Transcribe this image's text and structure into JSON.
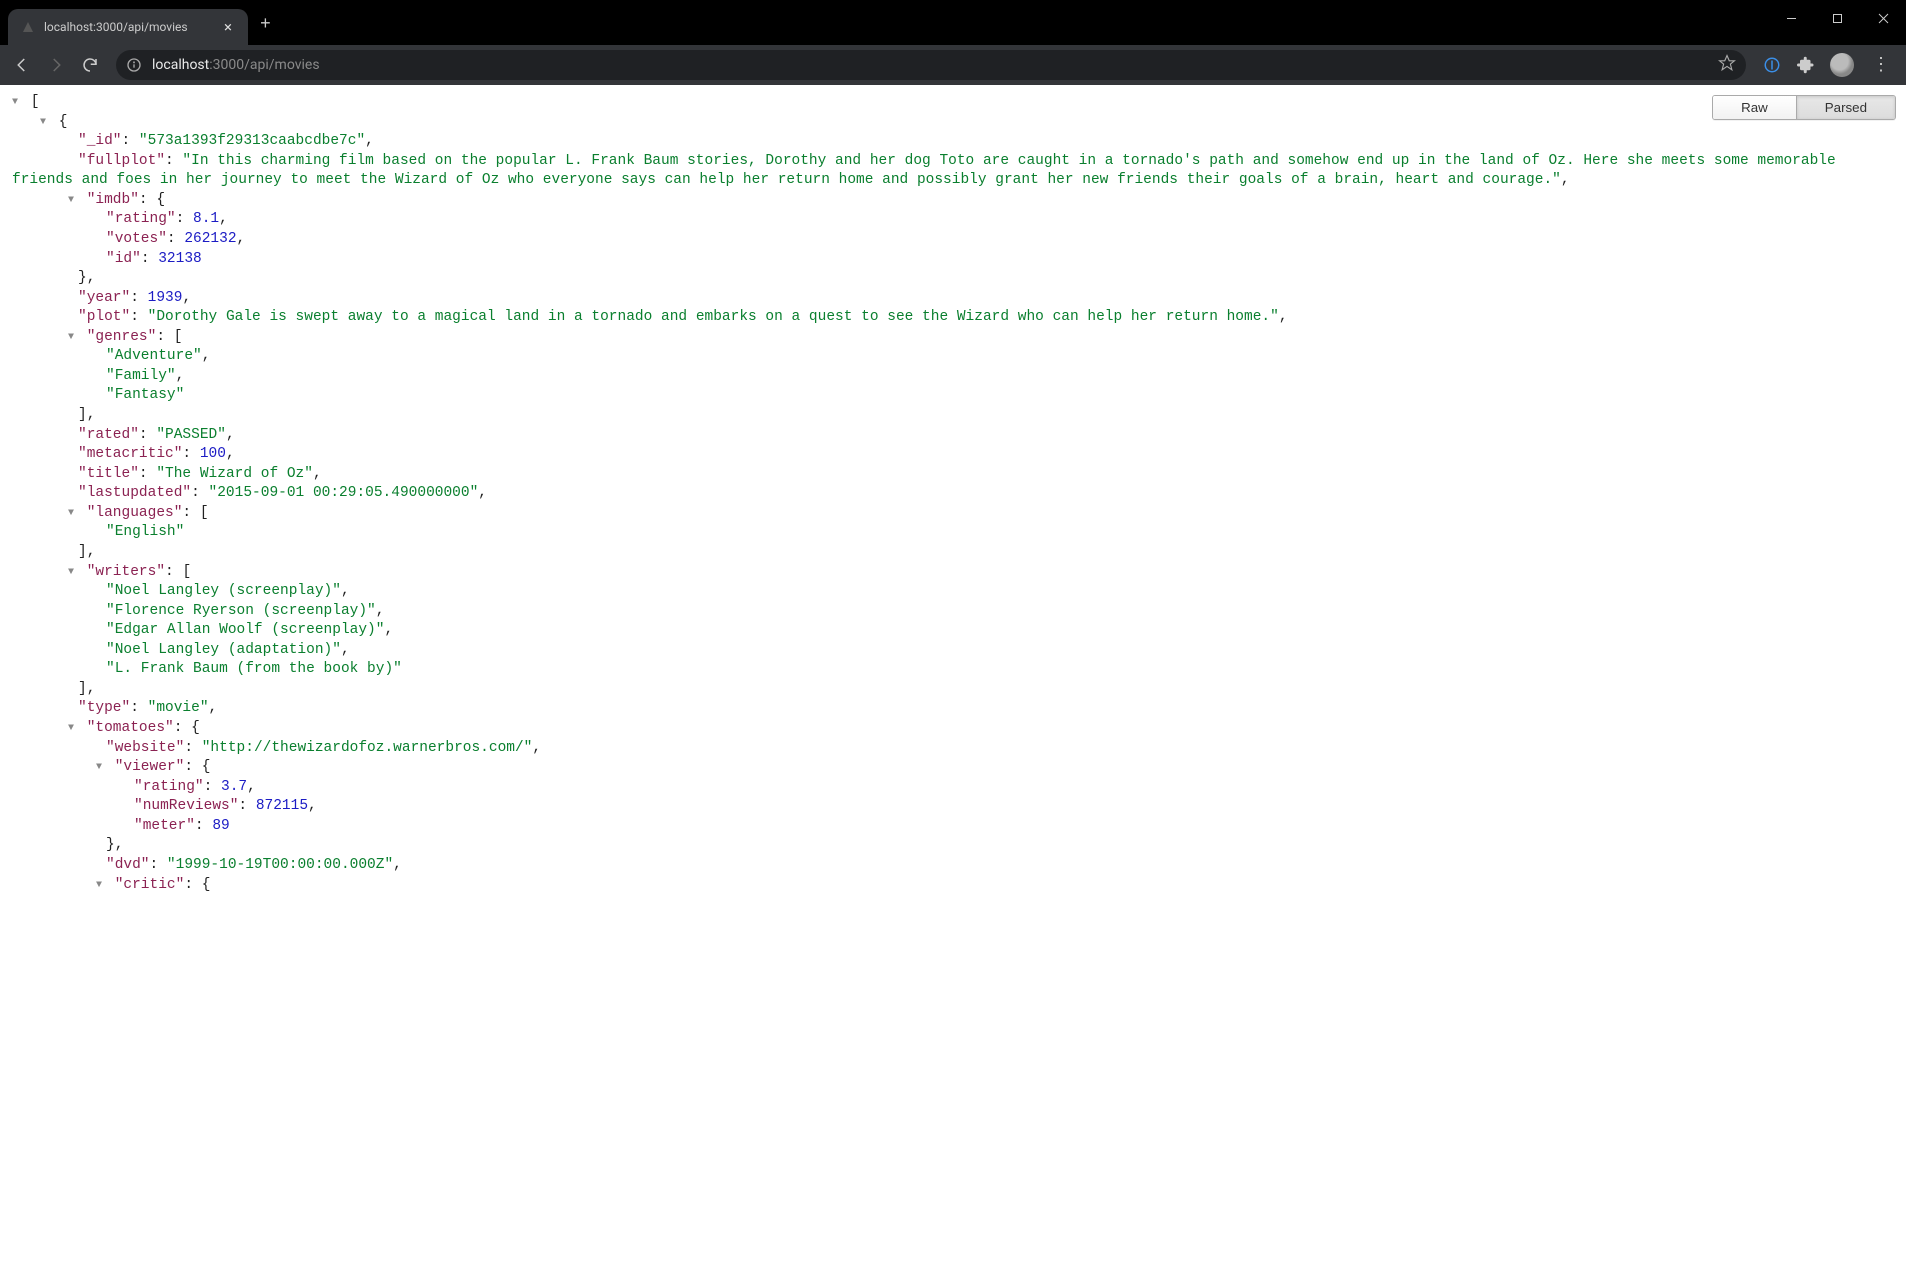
{
  "window": {
    "tab_title": "localhost:3000/api/movies",
    "url_host": "localhost",
    "url_port": ":3000",
    "url_path": "/api/movies"
  },
  "overlay": {
    "raw_label": "Raw",
    "parsed_label": "Parsed",
    "active": "parsed"
  },
  "json": {
    "records": [
      {
        "_id": "573a1393f29313caabcdbe7c",
        "fullplot": "In this charming film based on the popular L. Frank Baum stories, Dorothy and her dog Toto are caught in a tornado's path and somehow end up in the land of Oz. Here she meets some memorable friends and foes in her journey to meet the Wizard of Oz who everyone says can help her return home and possibly grant her new friends their goals of a brain, heart and courage.",
        "imdb": {
          "rating": 8.1,
          "votes": 262132,
          "id": 32138
        },
        "year": 1939,
        "plot": "Dorothy Gale is swept away to a magical land in a tornado and embarks on a quest to see the Wizard who can help her return home.",
        "genres": [
          "Adventure",
          "Family",
          "Fantasy"
        ],
        "rated": "PASSED",
        "metacritic": 100,
        "title": "The Wizard of Oz",
        "lastupdated": "2015-09-01 00:29:05.490000000",
        "languages": [
          "English"
        ],
        "writers": [
          "Noel Langley (screenplay)",
          "Florence Ryerson (screenplay)",
          "Edgar Allan Woolf (screenplay)",
          "Noel Langley (adaptation)",
          "L. Frank Baum (from the book by)"
        ],
        "type": "movie",
        "tomatoes": {
          "website": "http://thewizardofoz.warnerbros.com/",
          "viewer": {
            "rating": 3.7,
            "numReviews": 872115,
            "meter": 89
          },
          "dvd": "1999-10-19T00:00:00.000Z",
          "critic": {}
        }
      }
    ]
  }
}
